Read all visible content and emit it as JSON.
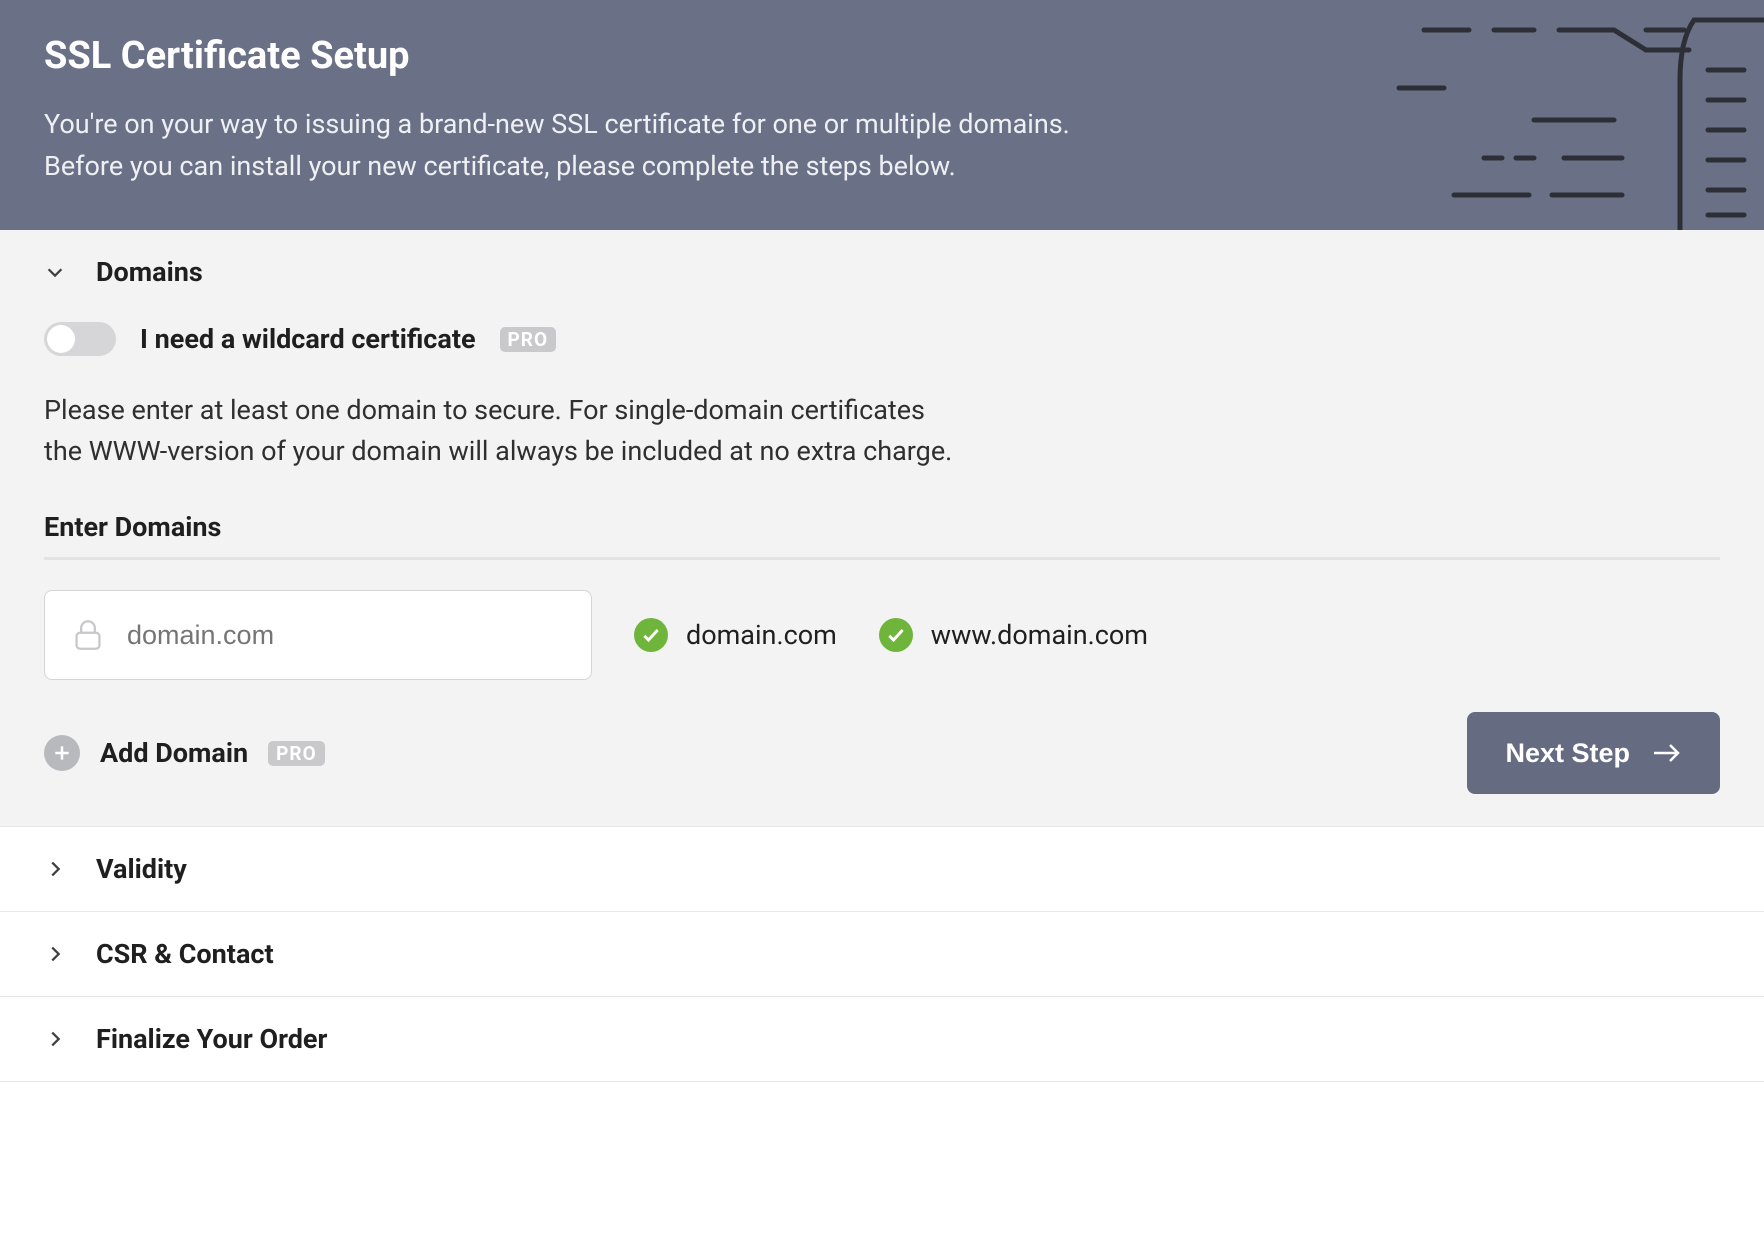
{
  "hero": {
    "title": "SSL Certificate Setup",
    "subtitle_line1": "You're on your way to issuing a brand-new SSL certificate for one or multiple domains.",
    "subtitle_line2": "Before you can install your new certificate, please complete the steps below."
  },
  "sections": {
    "domains": {
      "title": "Domains",
      "expanded": true,
      "wildcard_toggle": {
        "label": "I need a wildcard certificate",
        "badge": "PRO",
        "on": false
      },
      "instruction_line1": "Please enter at least one domain to secure. For single-domain certificates",
      "instruction_line2": "the WWW-version of your domain will always be included at no extra charge.",
      "enter_domains_label": "Enter Domains",
      "domain_input_placeholder": "domain.com",
      "domain_input_value": "",
      "verified": [
        "domain.com",
        "www.domain.com"
      ],
      "add_domain": {
        "label": "Add Domain",
        "badge": "PRO"
      },
      "next_button": "Next Step"
    },
    "validity": {
      "title": "Validity"
    },
    "csr": {
      "title": "CSR & Contact"
    },
    "finalize": {
      "title": "Finalize Your Order"
    }
  }
}
